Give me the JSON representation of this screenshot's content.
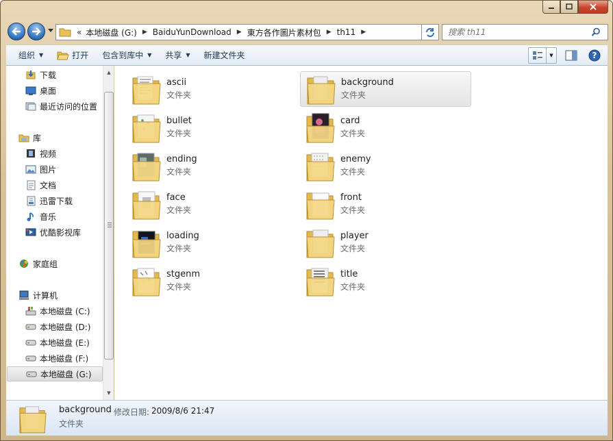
{
  "window": {
    "minimize_icon": "minimize-icon",
    "maximize_icon": "maximize-icon",
    "close_icon": "close-icon"
  },
  "nav": {
    "back_icon": "back-arrow-icon",
    "forward_icon": "forward-arrow-icon",
    "address_overflow": "«",
    "breadcrumbs": [
      "本地磁盘 (G:)",
      "BaiduYunDownload",
      "東方各作圖片素材包",
      "th11"
    ],
    "refresh_icon": "refresh-icon",
    "search_placeholder": "搜索 th11"
  },
  "toolbar": {
    "organize": "组织",
    "open": "打开",
    "include_in_library": "包含到库中",
    "share": "共享",
    "new_folder": "新建文件夹"
  },
  "sidebar": {
    "favorites": [
      {
        "label": "下载",
        "icon": "downloads-icon"
      },
      {
        "label": "桌面",
        "icon": "desktop-icon"
      },
      {
        "label": "最近访问的位置",
        "icon": "recent-places-icon"
      }
    ],
    "library_header": "库",
    "libraries": [
      {
        "label": "视频",
        "icon": "video-icon"
      },
      {
        "label": "图片",
        "icon": "pictures-icon"
      },
      {
        "label": "文档",
        "icon": "documents-icon"
      },
      {
        "label": "迅雷下载",
        "icon": "thunder-download-icon"
      },
      {
        "label": "音乐",
        "icon": "music-icon"
      },
      {
        "label": "优酷影视库",
        "icon": "youku-icon"
      }
    ],
    "homegroup": "家庭组",
    "computer_header": "计算机",
    "drives": [
      {
        "label": "本地磁盘 (C:)",
        "icon": "system-drive-icon"
      },
      {
        "label": "本地磁盘 (D:)",
        "icon": "drive-icon"
      },
      {
        "label": "本地磁盘 (E:)",
        "icon": "drive-icon"
      },
      {
        "label": "本地磁盘 (F:)",
        "icon": "drive-icon"
      },
      {
        "label": "本地磁盘 (G:)",
        "icon": "drive-icon"
      }
    ]
  },
  "folders": [
    {
      "name": "ascii",
      "type": "文件夹"
    },
    {
      "name": "background",
      "type": "文件夹"
    },
    {
      "name": "bullet",
      "type": "文件夹"
    },
    {
      "name": "card",
      "type": "文件夹"
    },
    {
      "name": "ending",
      "type": "文件夹"
    },
    {
      "name": "enemy",
      "type": "文件夹"
    },
    {
      "name": "face",
      "type": "文件夹"
    },
    {
      "name": "front",
      "type": "文件夹"
    },
    {
      "name": "loading",
      "type": "文件夹"
    },
    {
      "name": "player",
      "type": "文件夹"
    },
    {
      "name": "stgenm",
      "type": "文件夹"
    },
    {
      "name": "title",
      "type": "文件夹"
    }
  ],
  "selected_folder": "background",
  "details": {
    "name": "background",
    "modified_label": "修改日期:",
    "modified_value": "2009/8/6 21:47",
    "type": "文件夹"
  },
  "colors": {
    "folder_yellow": "#f0d27a",
    "frame_tan": "#d9c29a",
    "toolbar_text": "#1e395b"
  }
}
